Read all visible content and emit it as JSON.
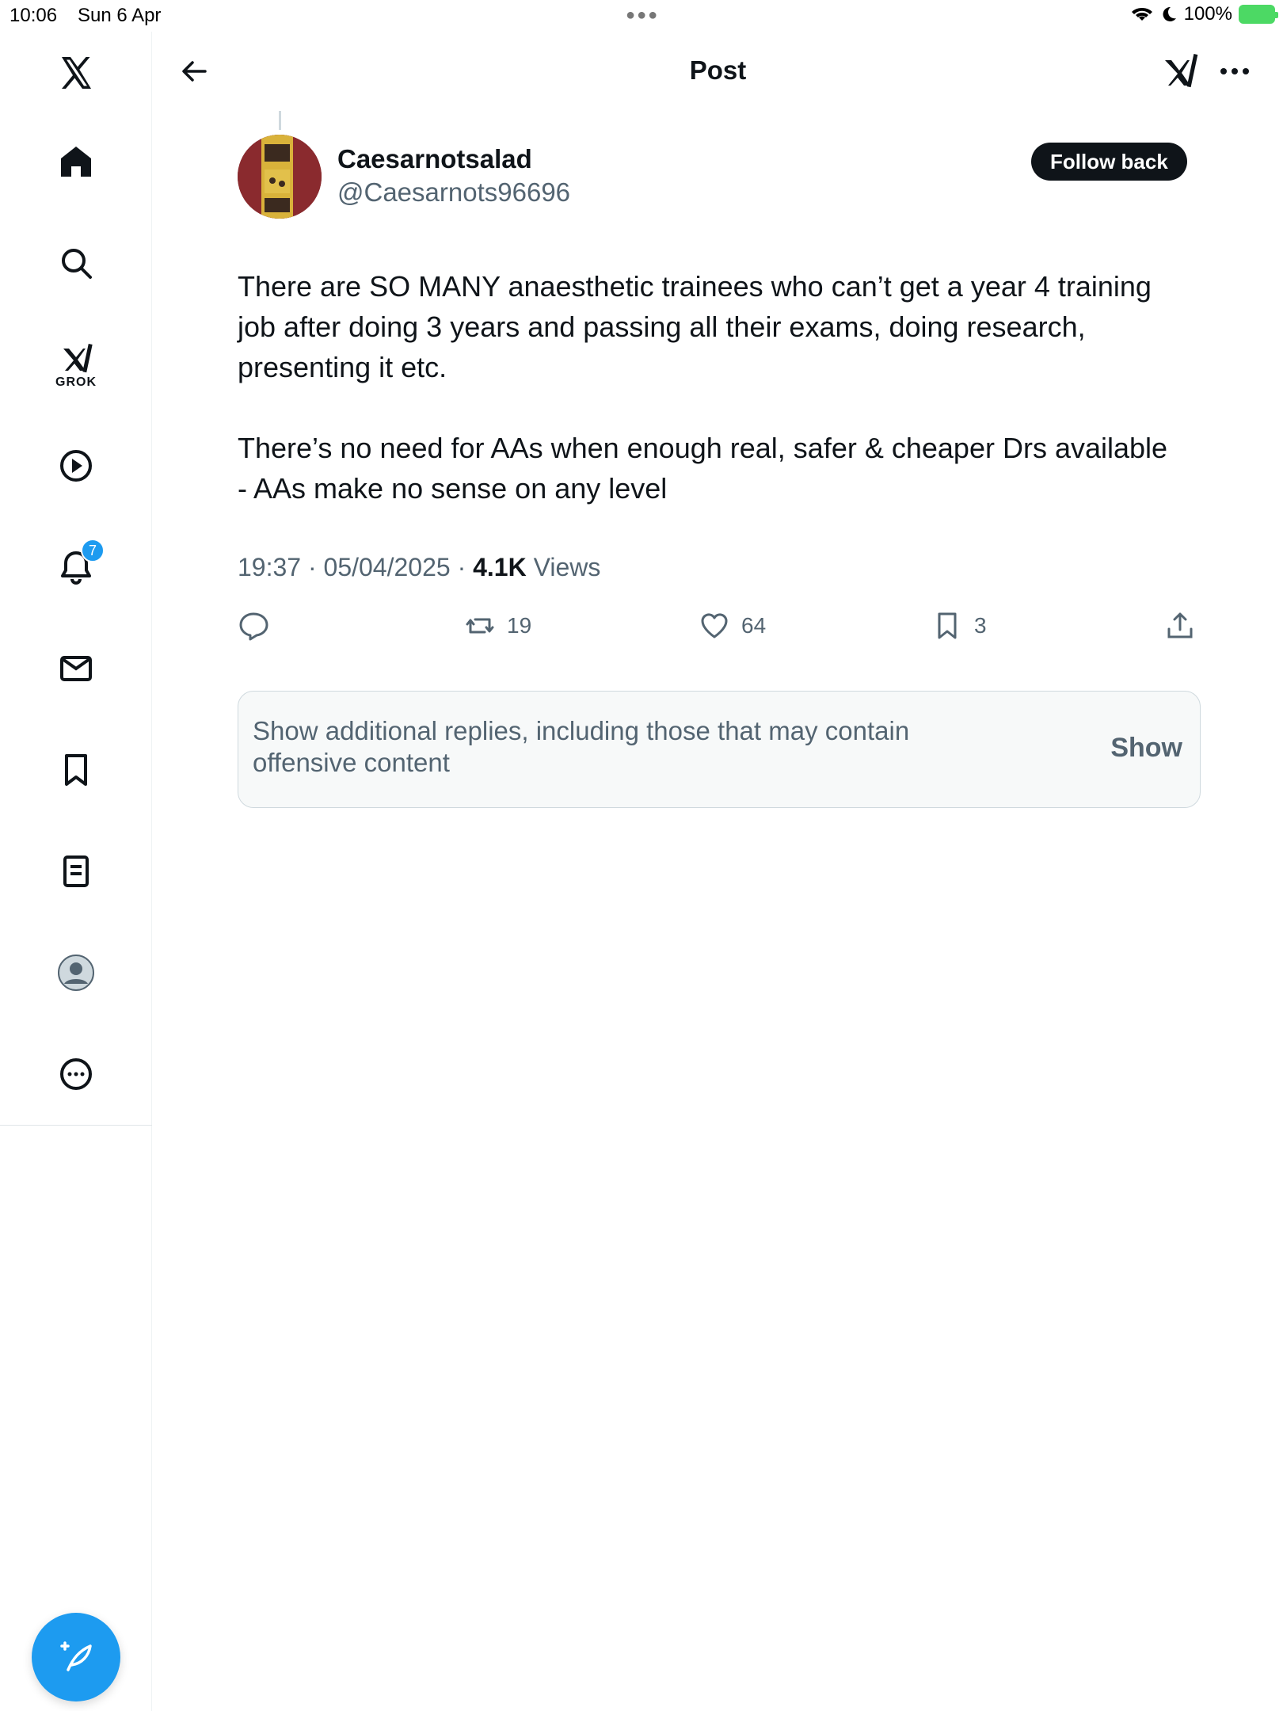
{
  "status_bar": {
    "time": "10:06",
    "date": "Sun 6 Apr",
    "battery": "100%"
  },
  "sidebar": {
    "grok_label": "GROK",
    "notification_count": "7"
  },
  "header": {
    "title": "Post"
  },
  "post": {
    "author_name": "Caesarnotsalad",
    "author_handle": "@Caesarnots96696",
    "follow_label": "Follow back",
    "text": "There are SO MANY anaesthetic trainees who can’t get a year 4 training job after doing 3 years and passing all their exams, doing research, presenting it etc.\n\nThere’s no need for AAs when enough real, safer & cheaper Drs available - AAs make no sense on any level",
    "timestamp": "19:37 · 05/04/2025 · ",
    "views_count": "4.1K",
    "views_label": " Views",
    "retweets": "19",
    "likes": "64",
    "bookmarks": "3"
  },
  "notice": {
    "text": "Show additional replies, including those that may contain offensive content",
    "show_label": "Show"
  },
  "colors": {
    "accent": "#1d9bf0",
    "text": "#0f1419",
    "secondary": "#536471"
  }
}
